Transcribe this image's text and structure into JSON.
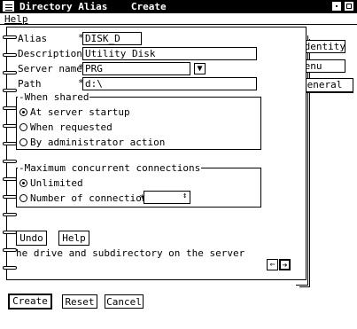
{
  "window": {
    "title": "Directory Alias    Create"
  },
  "menu": {
    "help": "Help"
  },
  "tabs": {
    "identity": "Identity",
    "menu": "Menu",
    "general": "General"
  },
  "fields": {
    "alias_label": "Alias",
    "alias_value": "DISK_D",
    "description_label": "Description",
    "description_value": "Utility Disk",
    "server_label": "Server name",
    "server_value": "PRG",
    "path_label": "Path",
    "path_value": "d:\\"
  },
  "when_shared": {
    "title": "When shared",
    "options": [
      "At server startup",
      "When requested",
      "By administrator action"
    ],
    "selected": 0
  },
  "max_connections": {
    "title": "Maximum concurrent connections",
    "options": [
      "Unlimited",
      "Number of connections"
    ],
    "selected": 0
  },
  "page_buttons": {
    "undo": "Undo",
    "help": "Help"
  },
  "status_text": "he drive and subdirectory on the server",
  "dialog_buttons": {
    "create": "Create",
    "reset": "Reset",
    "cancel": "Cancel"
  }
}
